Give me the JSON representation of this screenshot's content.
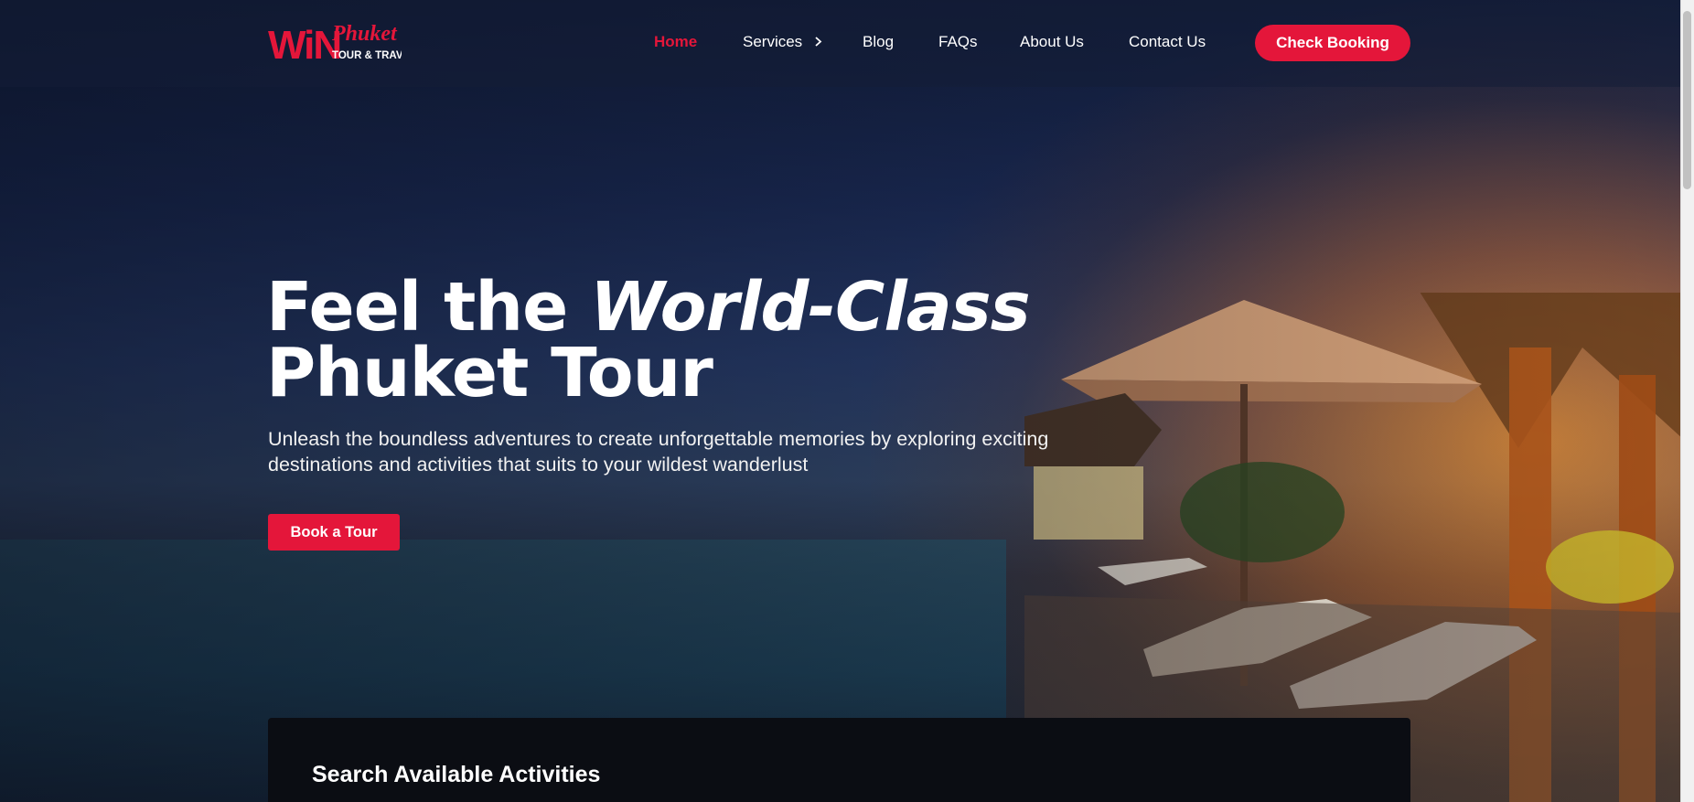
{
  "brand": {
    "logo_main": "WiN",
    "logo_script": "Phuket",
    "logo_sub": "TOUR & TRAVEL",
    "accent_color": "#e4163a"
  },
  "nav": {
    "items": [
      {
        "label": "Home",
        "active": true
      },
      {
        "label": "Services",
        "has_dropdown": true
      },
      {
        "label": "Blog"
      },
      {
        "label": "FAQs"
      },
      {
        "label": "About Us"
      },
      {
        "label": "Contact Us"
      }
    ],
    "cta_label": "Check Booking"
  },
  "hero": {
    "title_part1": "Feel the ",
    "title_emphasis": "World-Class",
    "title_line2": "Phuket Tour",
    "subtitle": "Unleash the boundless adventures to create unforgettable memories by exploring exciting destinations and activities that suits to your wildest wanderlust",
    "button_label": "Book a Tour"
  },
  "search": {
    "title": "Search Available Activities"
  },
  "icons": {
    "services_dropdown": "chevron-right-icon"
  }
}
